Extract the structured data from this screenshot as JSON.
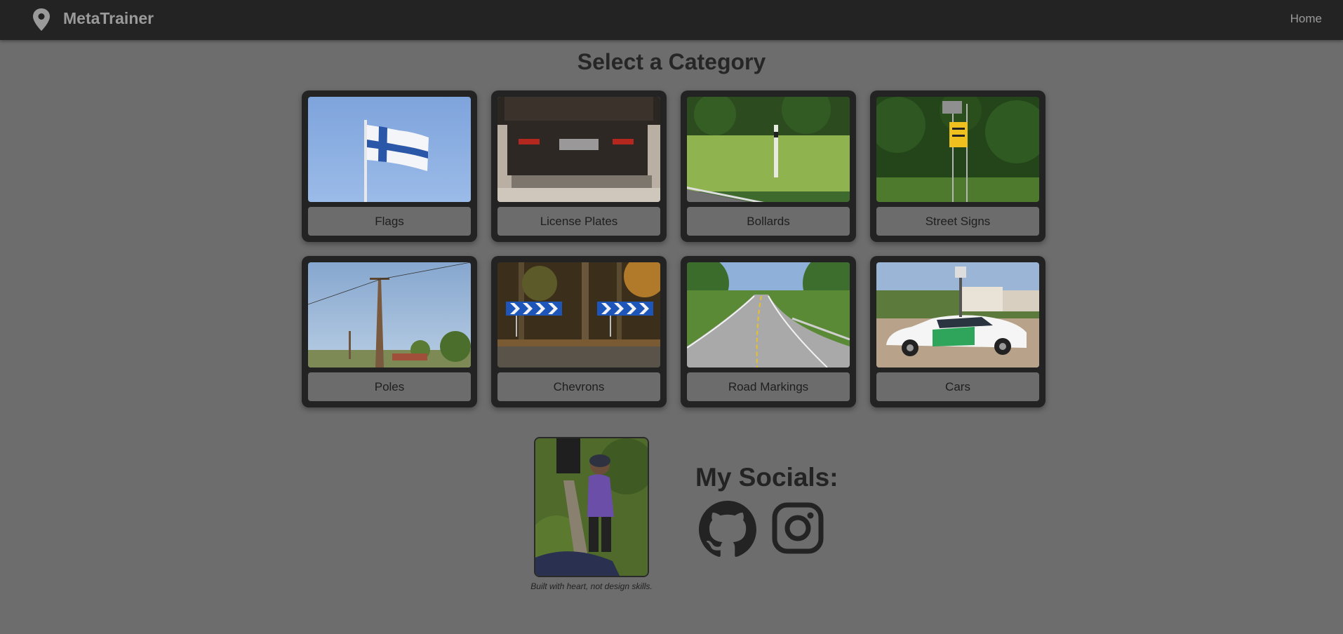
{
  "navbar": {
    "brand": "MetaTrainer",
    "brand_icon": "location-pin-icon",
    "links": [
      {
        "label": "Home"
      }
    ]
  },
  "page_title": "Select a Category",
  "categories": [
    {
      "label": "Flags",
      "image": "finnish-flag-photo"
    },
    {
      "label": "License Plates",
      "image": "truck-license-plate-photo"
    },
    {
      "label": "Bollards",
      "image": "roadside-bollard-photo"
    },
    {
      "label": "Street Signs",
      "image": "street-sign-photo"
    },
    {
      "label": "Poles",
      "image": "utility-pole-photo"
    },
    {
      "label": "Chevrons",
      "image": "chevron-signs-photo"
    },
    {
      "label": "Road Markings",
      "image": "road-markings-photo"
    },
    {
      "label": "Cars",
      "image": "street-view-car-photo"
    }
  ],
  "footer": {
    "tagline": "Built with heart, not design skills.",
    "socials_title": "My Socials:",
    "socials": [
      {
        "icon": "github-icon"
      },
      {
        "icon": "instagram-icon"
      }
    ]
  },
  "colors": {
    "background": "#6d6d6d",
    "navbar": "#232323",
    "card": "#232323",
    "card_label": "#6c6c6c"
  }
}
